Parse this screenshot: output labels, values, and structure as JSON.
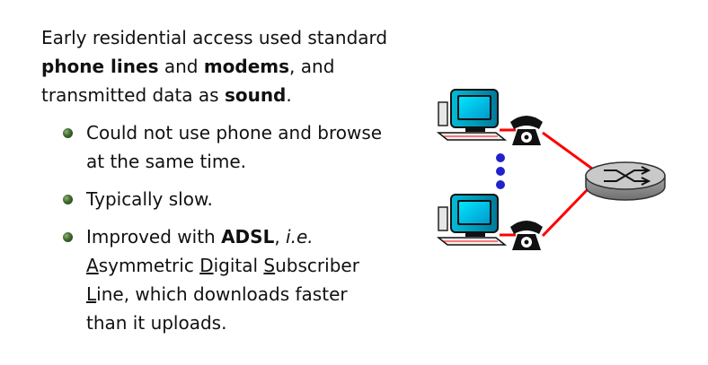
{
  "intro": {
    "line1": "Early residential access used standard",
    "line2_bold1": "phone lines",
    "line2_mid": " and ",
    "line2_bold2": "modems",
    "line2_end": ", and",
    "line3_start": "transmitted data as ",
    "line3_bold": "sound",
    "line3_end": "."
  },
  "bullets": [
    {
      "text": "Could not use phone and browse at the same time."
    },
    {
      "text": "Typically slow."
    },
    {
      "pre": "Improved with ",
      "bold": "ADSL",
      "comma": ", ",
      "italic": "i.e.",
      "w1_first": "A",
      "w1_rest": "symmetric ",
      "w2_first": "D",
      "w2_rest": "igital ",
      "w3_first": "S",
      "w3_rest": "ubscriber",
      "w4_first": "L",
      "w4_rest": "ine, which downloads faster than it uploads."
    }
  ],
  "diagram": {
    "link_color": "#ff0000",
    "dots_color": "#2222cc",
    "router_color": "#c9c9c9",
    "icons": [
      "computer-icon",
      "telephone-icon",
      "computer-icon",
      "telephone-icon",
      "router-icon"
    ]
  }
}
